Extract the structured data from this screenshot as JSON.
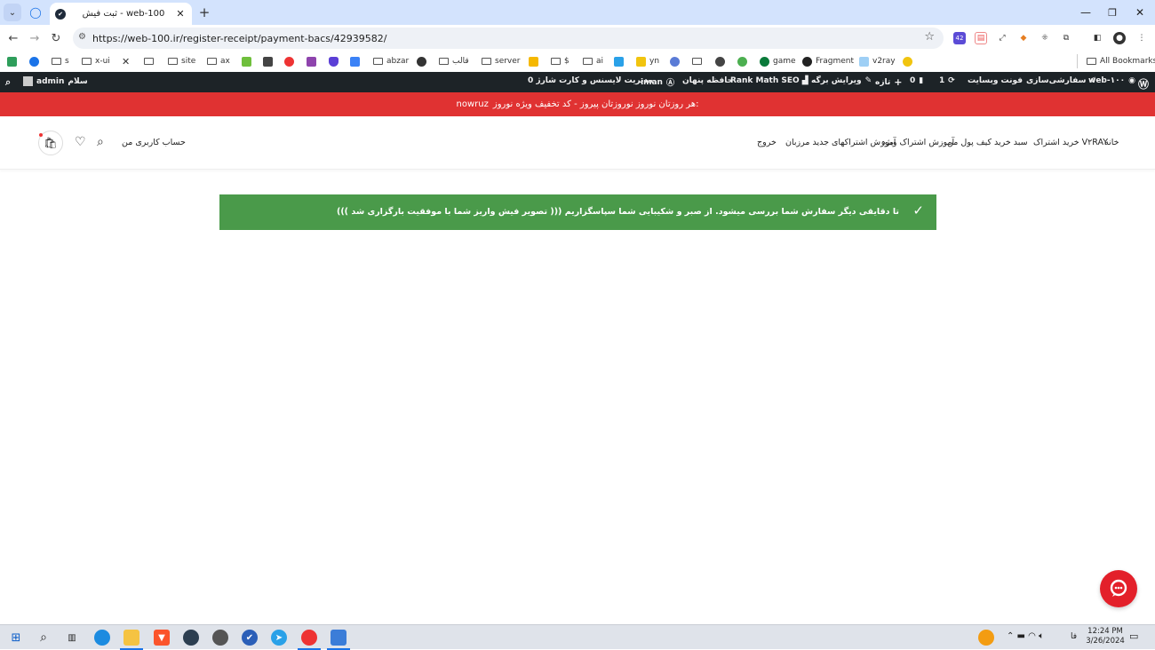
{
  "browser": {
    "tab_title": "ثبت فیش - web-100",
    "url": "https://web-100.ir/register-receipt/payment-bacs/42939582/",
    "extension_badge": "42",
    "all_bookmarks": "All Bookmarks"
  },
  "bookmarks": [
    {
      "label": "s",
      "type": "folder"
    },
    {
      "label": "x-ui",
      "type": "folder"
    },
    {
      "label": "",
      "type": "icon"
    },
    {
      "label": "",
      "type": "folder"
    },
    {
      "label": "site",
      "type": "folder"
    },
    {
      "label": "ax",
      "type": "folder"
    },
    {
      "label": "abzar",
      "type": "folder"
    },
    {
      "label": "قالب",
      "type": "folder"
    },
    {
      "label": "server",
      "type": "folder"
    },
    {
      "label": "$",
      "type": "folder"
    },
    {
      "label": "ai",
      "type": "folder"
    },
    {
      "label": "yn",
      "type": "icon"
    },
    {
      "label": "game",
      "type": "icon"
    },
    {
      "label": "Fragment",
      "type": "icon"
    },
    {
      "label": "v2ray",
      "type": "icon"
    }
  ],
  "adminbar": {
    "site_name": "web-۱۰۰",
    "customize": "سفارشی‌سازی",
    "font": "فونت وبسایت",
    "updates": "1",
    "comments": "0",
    "new": "تازه",
    "edit_page": "ویرایش برگه",
    "seo": "Rank Math SEO",
    "hidden_cache": "حافظه پنهان",
    "user_plugin": "iman",
    "license": "مدیریت لایسنس و کارت شارژ 0",
    "greeting": "سلام",
    "username": "admin"
  },
  "promo": {
    "text": "هر روزتان نوروز نوروزتان پیروز - کد تخفیف ویژه نوروز:",
    "code": "nowruz"
  },
  "site_nav": {
    "items": [
      "خانه",
      "خرید اشتراک V۲RAY",
      "سبد خرید",
      "کیف پول من",
      "آموزش اشتراک ویژه",
      "آموزش اشتراکهای جدید مرزبان",
      "خروج"
    ],
    "account": "حساب کاربری من"
  },
  "notice": {
    "text": "((( تصویر فیش واریز شما با موفقیت بارگزاری شد ))) تا دقایقی دیگر سفارش شما بررسی میشود. از صبر و شکیبایی شما سپاسگزاریم"
  },
  "taskbar": {
    "time": "12:24 PM",
    "date": "3/26/2024",
    "lang": "فا"
  },
  "colors": {
    "promo_bg": "#e03232",
    "notice_bg": "#4a9a4a",
    "adminbar_bg": "#1d2327",
    "tabstrip_bg": "#d3e3fd"
  }
}
